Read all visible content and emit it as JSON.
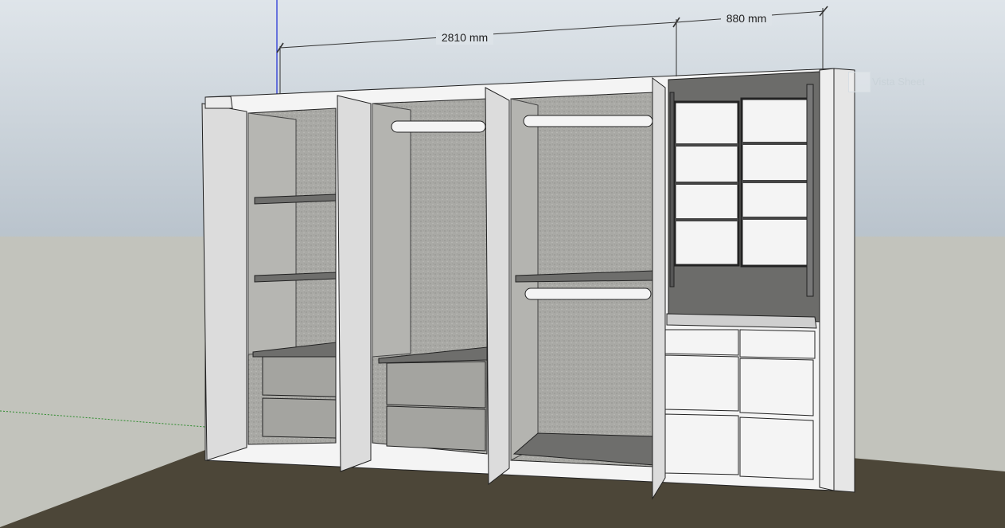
{
  "viewport": {
    "dimensions": [
      {
        "label": "2810 mm"
      },
      {
        "label": "880 mm"
      }
    ],
    "overlay_label": "Vista Sheet"
  },
  "colors": {
    "sky_top": "#dfe5ea",
    "sky_bottom": "#b9c3cc",
    "ground": "#c2c3bc",
    "floor": "#4c4638",
    "carcass": "#f4f4f4",
    "shelf": "#6e6e6c",
    "back_panel": "#a6a6a2",
    "door": "#dcdcdc",
    "axis_blue": "#1c2bd6",
    "axis_green": "#2a8a2a"
  }
}
